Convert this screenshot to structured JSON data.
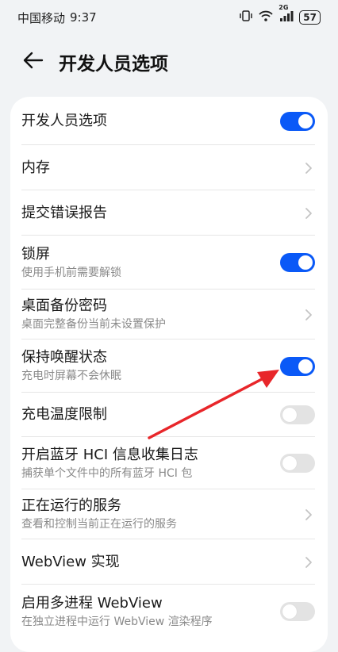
{
  "status_bar": {
    "carrier": "中国移动",
    "time": "9:37",
    "network": "2G",
    "battery": "57"
  },
  "header": {
    "title": "开发人员选项"
  },
  "rows": [
    {
      "title": "开发人员选项",
      "control": "toggle",
      "state": "on"
    },
    {
      "title": "内存",
      "control": "chevron"
    },
    {
      "title": "提交错误报告",
      "control": "chevron"
    },
    {
      "title": "锁屏",
      "subtitle": "使用手机前需要解锁",
      "control": "toggle",
      "state": "on"
    },
    {
      "title": "桌面备份密码",
      "subtitle": "桌面完整备份当前未设置保护",
      "control": "chevron"
    },
    {
      "title": "保持唤醒状态",
      "subtitle": "充电时屏幕不会休眠",
      "control": "toggle",
      "state": "on"
    },
    {
      "title": "充电温度限制",
      "control": "toggle",
      "state": "off"
    },
    {
      "title": "开启蓝牙 HCI 信息收集日志",
      "subtitle": "捕获单个文件中的所有蓝牙 HCI 包",
      "control": "toggle",
      "state": "off"
    },
    {
      "title": "正在运行的服务",
      "subtitle": "查看和控制当前正在运行的服务",
      "control": "chevron"
    },
    {
      "title": "WebView 实现",
      "control": "chevron"
    },
    {
      "title": "启用多进程 WebView",
      "subtitle": "在独立进程中运行 WebView 渲染程序",
      "control": "toggle",
      "state": "off"
    }
  ],
  "colors": {
    "accent": "#0a59f7",
    "annotation_arrow": "#e8262a"
  }
}
